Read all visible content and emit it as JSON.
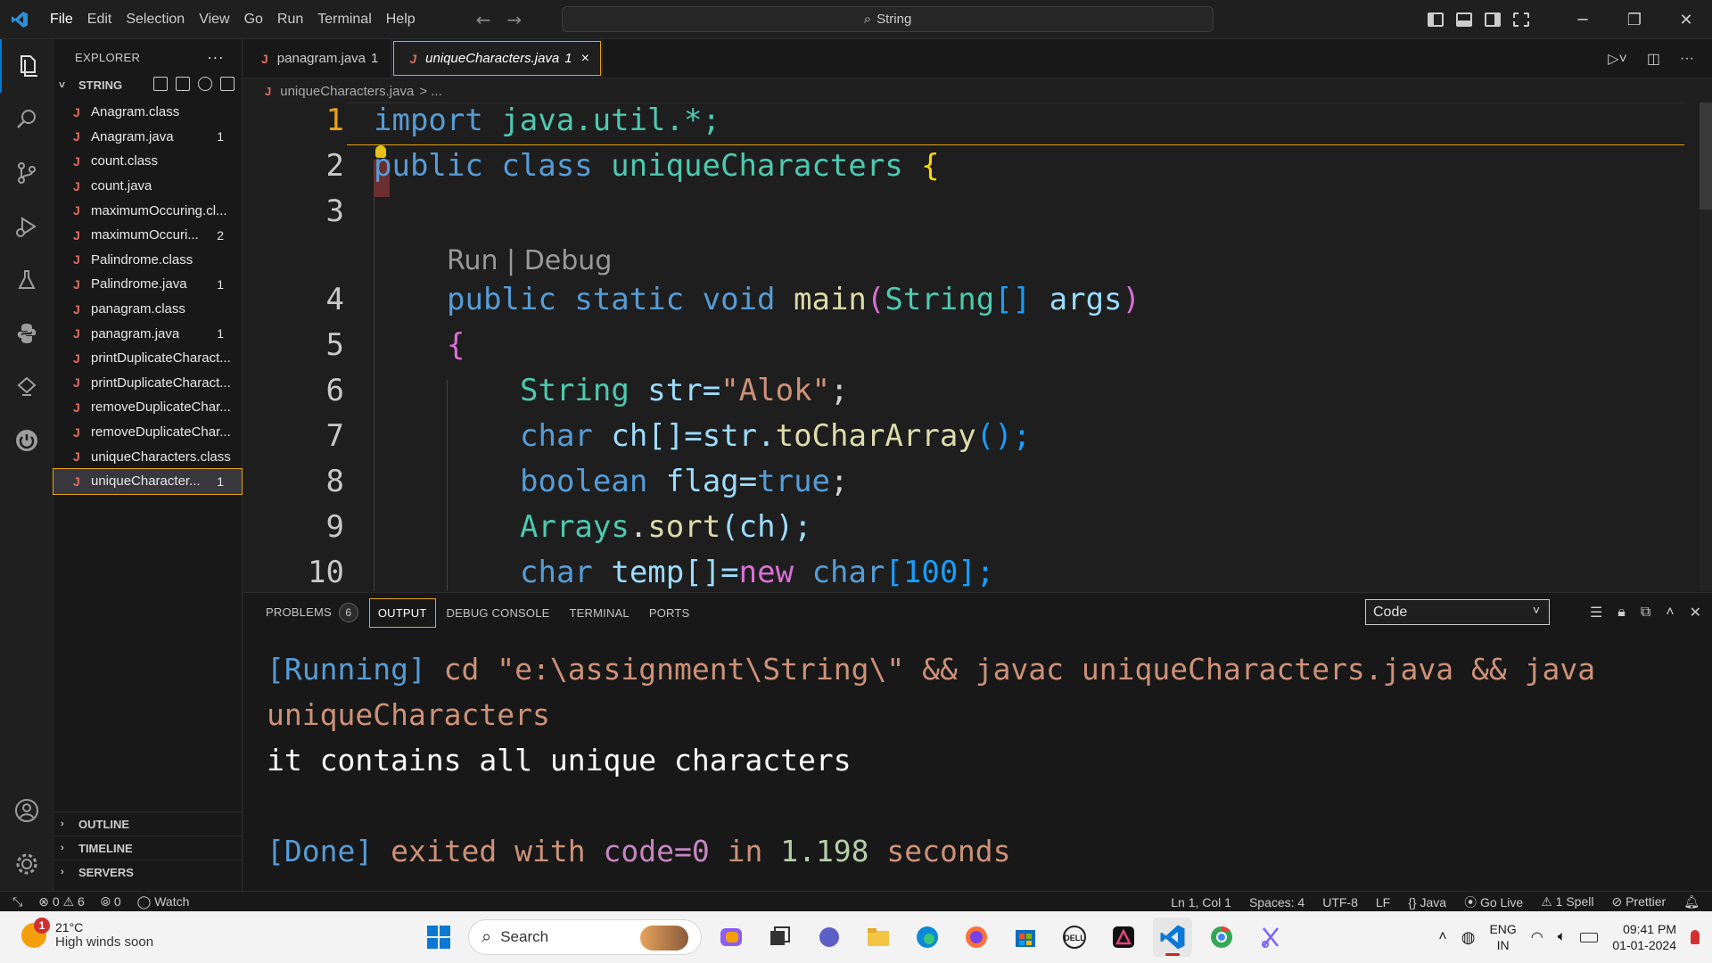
{
  "titlebar": {
    "menu": [
      "File",
      "Edit",
      "Selection",
      "View",
      "Go",
      "Run",
      "Terminal",
      "Help"
    ],
    "command_center": "String",
    "colors": {
      "accent": "#0078d4",
      "focus_outline": "#e8a317"
    }
  },
  "activity_bar": {
    "top": [
      "files-icon",
      "search-icon",
      "source-control-icon",
      "run-debug-icon",
      "testing-icon",
      "python-icon",
      "remote-explorer-icon",
      "power-icon"
    ],
    "bottom": [
      "account-icon",
      "settings-gear-icon"
    ]
  },
  "explorer": {
    "title": "EXPLORER",
    "more": "···",
    "folder": "STRING",
    "files": [
      {
        "name": "Anagram.class",
        "count": ""
      },
      {
        "name": "Anagram.java",
        "count": "1"
      },
      {
        "name": "count.class",
        "count": ""
      },
      {
        "name": "count.java",
        "count": ""
      },
      {
        "name": "maximumOccuring.cl...",
        "count": ""
      },
      {
        "name": "maximumOccuri...",
        "count": "2"
      },
      {
        "name": "Palindrome.class",
        "count": ""
      },
      {
        "name": "Palindrome.java",
        "count": "1"
      },
      {
        "name": "panagram.class",
        "count": ""
      },
      {
        "name": "panagram.java",
        "count": "1"
      },
      {
        "name": "printDuplicateCharact...",
        "count": ""
      },
      {
        "name": "printDuplicateCharact...",
        "count": ""
      },
      {
        "name": "removeDuplicateChar...",
        "count": ""
      },
      {
        "name": "removeDuplicateChar...",
        "count": ""
      },
      {
        "name": "uniqueCharacters.class",
        "count": ""
      },
      {
        "name": "uniqueCharacter...",
        "count": "1"
      }
    ],
    "sections": [
      "OUTLINE",
      "TIMELINE",
      "SERVERS"
    ]
  },
  "tabs": [
    {
      "name": "panagram.java",
      "count": "1"
    },
    {
      "name": "uniqueCharacters.java",
      "count": "1",
      "close": "×"
    }
  ],
  "breadcrumb": {
    "file": "uniqueCharacters.java",
    "rest": "> ..."
  },
  "editor": {
    "line_numbers": [
      "1",
      "2",
      "3",
      "4",
      "5",
      "6",
      "7",
      "8",
      "9",
      "10"
    ],
    "codelens": "Run | Debug",
    "lines": {
      "l1": {
        "kw": "import",
        "pkg": " java.util.*;"
      },
      "l2": {
        "kw1": "public",
        "kw2": "class",
        "name": "uniqueCharacters",
        "brace": "{"
      },
      "l4": {
        "kw1": "public",
        "kw2": "static",
        "kw3": "void",
        "fn": "main",
        "p_open": "(",
        "type": "String",
        "arr": "[]",
        "arg": " args",
        "p_close": ")"
      },
      "l5": {
        "brace": "{"
      },
      "l6": {
        "type": "String",
        "rest": " str=",
        "str": "\"Alok\"",
        "end": ";"
      },
      "l7": {
        "kw": "char",
        "rest": " ch[]=str.",
        "fn": "toCharArray",
        "end": "();"
      },
      "l8": {
        "kw": "boolean",
        "rest": " flag=",
        "val": "true",
        "end": ";"
      },
      "l9": {
        "type": "Arrays",
        "rest": ".",
        "fn": "sort",
        "end": "(ch);"
      },
      "l10": {
        "kw": "char",
        "rest": " temp[]=",
        "new": "new",
        "kw2": "char",
        "end": "[100];"
      }
    }
  },
  "panel": {
    "tabs": [
      "PROBLEMS",
      "OUTPUT",
      "DEBUG CONSOLE",
      "TERMINAL",
      "PORTS"
    ],
    "problems_badge": "6",
    "output_channel": "Code",
    "output": {
      "running_tag": "[Running]",
      "command": " cd \"e:\\assignment\\String\\\" && javac uniqueCharacters.java && java",
      "command_cont": "uniqueCharacters",
      "result": "it contains all unique characters",
      "done_tag": "[Done]",
      "done_text": " exited with ",
      "done_code": "code=0",
      "done_in": " in ",
      "done_time": "1.198",
      "done_unit": " seconds"
    }
  },
  "statusbar": {
    "errors": "0",
    "warnings": "6",
    "ports": "0",
    "watch": "Watch",
    "position": "Ln 1, Col 1",
    "spaces": "Spaces: 4",
    "encoding": "UTF-8",
    "eol": "LF",
    "language": "Java",
    "golive": "Go Live",
    "spell": "1 Spell",
    "prettier": "Prettier"
  },
  "taskbar": {
    "weather_temp": "21°C",
    "weather_text": "High winds soon",
    "weather_alert": "1",
    "search": "Search",
    "lang1": "ENG",
    "lang2": "IN",
    "time": "09:41 PM",
    "date": "01-01-2024"
  }
}
